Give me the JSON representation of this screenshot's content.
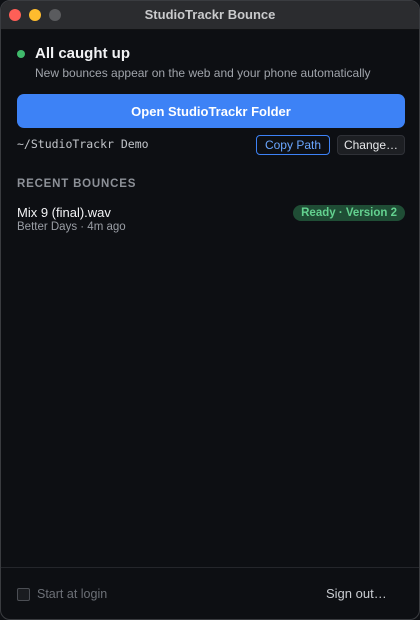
{
  "window": {
    "title": "StudioTrackr Bounce"
  },
  "status": {
    "title": "All caught up",
    "subtitle": "New bounces appear on the web and your phone automatically",
    "indicator_color": "#3fb96b"
  },
  "folder": {
    "open_button_label": "Open StudioTrackr Folder",
    "path": "~/StudioTrackr Demo",
    "copy_path_label": "Copy Path",
    "change_label": "Change…"
  },
  "recent": {
    "heading": "RECENT BOUNCES",
    "items": [
      {
        "name": "Mix 9 (final).wav",
        "meta": "Better Days · 4m ago",
        "status": "Ready · Version 2"
      }
    ]
  },
  "footer": {
    "start_at_login_label": "Start at login",
    "start_at_login_checked": false,
    "sign_out_label": "Sign out…"
  },
  "colors": {
    "accent": "#3d82f6",
    "ready_badge_bg": "#1f4d35",
    "ready_badge_text": "#63d18f"
  }
}
